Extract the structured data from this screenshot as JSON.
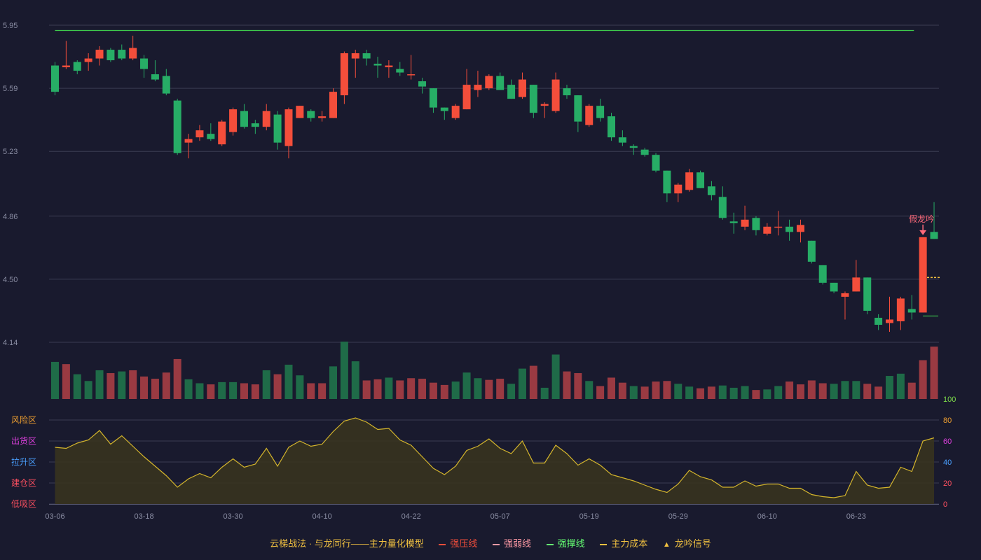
{
  "chart_data": {
    "type": "candlestick",
    "price_axis": {
      "ticks": [
        "5.95",
        "5.59",
        "5.23",
        "4.86",
        "4.50",
        "4.14"
      ],
      "min": 4.14,
      "max": 5.95
    },
    "x_ticks": [
      {
        "index": 0,
        "label": "03-06"
      },
      {
        "index": 8,
        "label": "03-18"
      },
      {
        "index": 16,
        "label": "03-30"
      },
      {
        "index": 24,
        "label": "04-10"
      },
      {
        "index": 32,
        "label": "04-22"
      },
      {
        "index": 40,
        "label": "05-07"
      },
      {
        "index": 48,
        "label": "05-19"
      },
      {
        "index": 56,
        "label": "05-29"
      },
      {
        "index": 64,
        "label": "06-10"
      },
      {
        "index": 72,
        "label": "06-23"
      }
    ],
    "candles": [
      [
        5.72,
        5.57,
        5.74,
        5.55
      ],
      [
        5.71,
        5.72,
        5.86,
        5.7
      ],
      [
        5.74,
        5.69,
        5.75,
        5.67
      ],
      [
        5.74,
        5.76,
        5.79,
        5.69
      ],
      [
        5.76,
        5.81,
        5.83,
        5.72
      ],
      [
        5.81,
        5.75,
        5.82,
        5.74
      ],
      [
        5.81,
        5.76,
        5.84,
        5.75
      ],
      [
        5.76,
        5.82,
        5.89,
        5.75
      ],
      [
        5.76,
        5.7,
        5.78,
        5.65
      ],
      [
        5.67,
        5.64,
        5.75,
        5.63
      ],
      [
        5.66,
        5.56,
        5.7,
        5.55
      ],
      [
        5.52,
        5.22,
        5.53,
        5.21
      ],
      [
        5.28,
        5.3,
        5.33,
        5.19
      ],
      [
        5.31,
        5.35,
        5.38,
        5.29
      ],
      [
        5.33,
        5.3,
        5.39,
        5.29
      ],
      [
        5.27,
        5.4,
        5.41,
        5.26
      ],
      [
        5.34,
        5.47,
        5.48,
        5.32
      ],
      [
        5.46,
        5.37,
        5.5,
        5.36
      ],
      [
        5.39,
        5.37,
        5.41,
        5.33
      ],
      [
        5.37,
        5.46,
        5.5,
        5.35
      ],
      [
        5.44,
        5.28,
        5.46,
        5.24
      ],
      [
        5.26,
        5.47,
        5.48,
        5.19
      ],
      [
        5.42,
        5.49,
        5.49,
        5.42
      ],
      [
        5.46,
        5.42,
        5.47,
        5.4
      ],
      [
        5.42,
        5.43,
        5.46,
        5.4
      ],
      [
        5.42,
        5.57,
        5.59,
        5.42
      ],
      [
        5.55,
        5.79,
        5.8,
        5.5
      ],
      [
        5.76,
        5.79,
        5.81,
        5.65
      ],
      [
        5.79,
        5.76,
        5.81,
        5.72
      ],
      [
        5.73,
        5.72,
        5.77,
        5.65
      ],
      [
        5.71,
        5.72,
        5.75,
        5.65
      ],
      [
        5.7,
        5.68,
        5.74,
        5.66
      ],
      [
        5.67,
        5.67,
        5.78,
        5.64
      ],
      [
        5.63,
        5.6,
        5.65,
        5.56
      ],
      [
        5.59,
        5.48,
        5.59,
        5.45
      ],
      [
        5.48,
        5.46,
        5.48,
        5.41
      ],
      [
        5.42,
        5.49,
        5.5,
        5.41
      ],
      [
        5.47,
        5.61,
        5.7,
        5.47
      ],
      [
        5.58,
        5.61,
        5.69,
        5.54
      ],
      [
        5.59,
        5.66,
        5.67,
        5.58
      ],
      [
        5.66,
        5.58,
        5.68,
        5.58
      ],
      [
        5.61,
        5.53,
        5.64,
        5.53
      ],
      [
        5.54,
        5.64,
        5.68,
        5.53
      ],
      [
        5.61,
        5.45,
        5.61,
        5.42
      ],
      [
        5.49,
        5.5,
        5.51,
        5.42
      ],
      [
        5.46,
        5.64,
        5.68,
        5.45
      ],
      [
        5.59,
        5.55,
        5.61,
        5.53
      ],
      [
        5.55,
        5.4,
        5.55,
        5.34
      ],
      [
        5.38,
        5.49,
        5.5,
        5.37
      ],
      [
        5.49,
        5.42,
        5.53,
        5.4
      ],
      [
        5.43,
        5.31,
        5.45,
        5.29
      ],
      [
        5.31,
        5.28,
        5.35,
        5.26
      ],
      [
        5.26,
        5.25,
        5.27,
        5.21
      ],
      [
        5.24,
        5.21,
        5.25,
        5.2
      ],
      [
        5.21,
        5.12,
        5.22,
        5.11
      ],
      [
        5.12,
        4.99,
        5.12,
        4.94
      ],
      [
        4.99,
        5.04,
        5.05,
        4.94
      ],
      [
        5.01,
        5.11,
        5.13,
        5.0
      ],
      [
        5.11,
        5.02,
        5.12,
        5.02
      ],
      [
        5.03,
        4.98,
        5.06,
        4.95
      ],
      [
        4.97,
        4.85,
        5.03,
        4.84
      ],
      [
        4.83,
        4.82,
        4.88,
        4.76
      ],
      [
        4.8,
        4.84,
        4.92,
        4.78
      ],
      [
        4.85,
        4.78,
        4.86,
        4.75
      ],
      [
        4.76,
        4.8,
        4.82,
        4.75
      ],
      [
        4.8,
        4.8,
        4.89,
        4.75
      ],
      [
        4.8,
        4.77,
        4.84,
        4.72
      ],
      [
        4.77,
        4.81,
        4.84,
        4.71
      ],
      [
        4.72,
        4.6,
        4.72,
        4.59
      ],
      [
        4.58,
        4.48,
        4.58,
        4.47
      ],
      [
        4.48,
        4.43,
        4.48,
        4.42
      ],
      [
        4.4,
        4.42,
        4.43,
        4.27
      ],
      [
        4.43,
        4.51,
        4.61,
        4.43
      ],
      [
        4.51,
        4.32,
        4.51,
        4.3
      ],
      [
        4.28,
        4.24,
        4.3,
        4.21
      ],
      [
        4.25,
        4.27,
        4.4,
        4.2
      ],
      [
        4.26,
        4.39,
        4.4,
        4.21
      ],
      [
        4.33,
        4.31,
        4.41,
        4.27
      ],
      [
        4.31,
        4.74,
        4.74,
        4.31
      ],
      [
        4.77,
        4.73,
        4.94,
        4.73
      ]
    ],
    "volume": [
      [
        66,
        "down"
      ],
      [
        62,
        "up"
      ],
      [
        44,
        "down"
      ],
      [
        32,
        "down"
      ],
      [
        51,
        "down"
      ],
      [
        46,
        "up"
      ],
      [
        49,
        "down"
      ],
      [
        51,
        "up"
      ],
      [
        40,
        "up"
      ],
      [
        36,
        "up"
      ],
      [
        47,
        "up"
      ],
      [
        71,
        "up"
      ],
      [
        35,
        "down"
      ],
      [
        28,
        "down"
      ],
      [
        26,
        "up"
      ],
      [
        30,
        "down"
      ],
      [
        30,
        "down"
      ],
      [
        28,
        "up"
      ],
      [
        26,
        "up"
      ],
      [
        51,
        "down"
      ],
      [
        44,
        "up"
      ],
      [
        61,
        "down"
      ],
      [
        42,
        "down"
      ],
      [
        28,
        "up"
      ],
      [
        28,
        "up"
      ],
      [
        58,
        "down"
      ],
      [
        102,
        "down"
      ],
      [
        67,
        "down"
      ],
      [
        33,
        "up"
      ],
      [
        35,
        "up"
      ],
      [
        38,
        "down"
      ],
      [
        33,
        "up"
      ],
      [
        37,
        "up"
      ],
      [
        36,
        "up"
      ],
      [
        29,
        "up"
      ],
      [
        25,
        "up"
      ],
      [
        31,
        "down"
      ],
      [
        47,
        "down"
      ],
      [
        37,
        "down"
      ],
      [
        34,
        "up"
      ],
      [
        36,
        "up"
      ],
      [
        27,
        "down"
      ],
      [
        54,
        "down"
      ],
      [
        59,
        "up"
      ],
      [
        20,
        "down"
      ],
      [
        79,
        "down"
      ],
      [
        49,
        "up"
      ],
      [
        46,
        "up"
      ],
      [
        32,
        "down"
      ],
      [
        23,
        "up"
      ],
      [
        38,
        "up"
      ],
      [
        29,
        "up"
      ],
      [
        23,
        "down"
      ],
      [
        22,
        "up"
      ],
      [
        31,
        "up"
      ],
      [
        32,
        "up"
      ],
      [
        27,
        "down"
      ],
      [
        22,
        "down"
      ],
      [
        19,
        "up"
      ],
      [
        22,
        "up"
      ],
      [
        24,
        "down"
      ],
      [
        20,
        "down"
      ],
      [
        23,
        "down"
      ],
      [
        16,
        "up"
      ],
      [
        17,
        "down"
      ],
      [
        23,
        "down"
      ],
      [
        31,
        "up"
      ],
      [
        26,
        "up"
      ],
      [
        33,
        "up"
      ],
      [
        28,
        "up"
      ],
      [
        27,
        "down"
      ],
      [
        32,
        "down"
      ],
      [
        32,
        "down"
      ],
      [
        27,
        "up"
      ],
      [
        22,
        "up"
      ],
      [
        41,
        "down"
      ],
      [
        45,
        "down"
      ],
      [
        29,
        "up"
      ],
      [
        69,
        "up"
      ],
      [
        93,
        "up"
      ]
    ],
    "volume_max": 102,
    "lines": {
      "strong_support_top": {
        "price": 5.92,
        "from": 0,
        "to": 77
      },
      "strong_support_recent": {
        "price": 4.29,
        "from": 78,
        "to": 79
      },
      "main_cost": {
        "price": 4.51,
        "from": 79,
        "to": 79
      }
    },
    "signal": {
      "label": "假龙吟",
      "index": 78
    },
    "indicator": {
      "ylim": [
        0,
        100
      ],
      "ticks": [
        "100",
        "80",
        "60",
        "40",
        "20",
        "0"
      ],
      "zones": [
        "风险区",
        "出货区",
        "拉升区",
        "建仓区",
        "低吸区"
      ],
      "values": [
        54,
        53,
        58,
        61,
        70,
        57,
        65,
        55,
        45,
        36,
        27,
        16,
        24,
        29,
        25,
        35,
        43,
        35,
        38,
        53,
        36,
        54,
        60,
        55,
        57,
        69,
        79,
        82,
        78,
        71,
        72,
        61,
        56,
        45,
        34,
        28,
        36,
        51,
        55,
        62,
        53,
        48,
        60,
        39,
        39,
        56,
        48,
        37,
        43,
        37,
        28,
        25,
        22,
        18,
        14,
        11,
        19,
        32,
        26,
        23,
        16,
        16,
        22,
        17,
        19,
        19,
        15,
        15,
        9,
        7,
        6,
        8,
        31,
        18,
        15,
        16,
        35,
        31,
        60,
        63
      ]
    },
    "colors": {
      "up": "#f44e3b",
      "down": "#27ad66",
      "volume_up": "#9a3a42",
      "volume_down": "#1f6b48",
      "line_green": "#3ecc4c",
      "indicator": "#d4b52c"
    }
  },
  "legend": {
    "title": "云梯战法 · 与龙同行——主力量化模型",
    "items": [
      {
        "label": "强压线",
        "icon": "solid-line",
        "color": "#f44e3b"
      },
      {
        "label": "强弱线",
        "icon": "dashed-line",
        "color": "#ff9aa5"
      },
      {
        "label": "强撑线",
        "icon": "solid-line",
        "color": "#65ff73"
      },
      {
        "label": "主力成本",
        "icon": "dashed-line",
        "color": "#f0c040"
      },
      {
        "label": "龙吟信号",
        "icon": "triangle-icon",
        "color": "#f0c040"
      }
    ]
  }
}
